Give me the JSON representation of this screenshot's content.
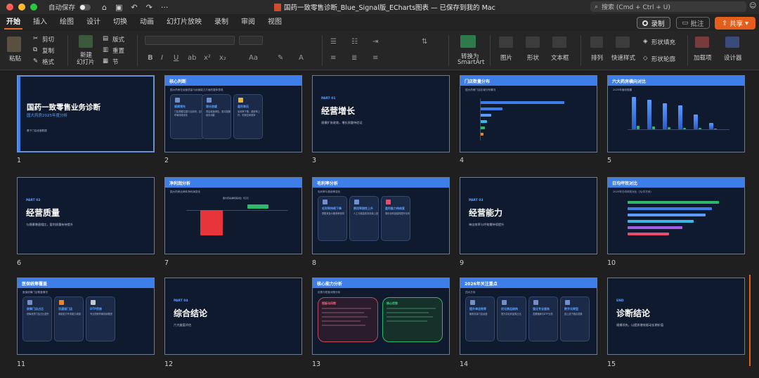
{
  "titlebar": {
    "autosave_label": "自动保存",
    "doc_title": "国药一致零售诊断_Blue_Signal版_ECharts图表 — 已保存到我的 Mac",
    "search_placeholder": "搜索 (Cmd + Ctrl + U)"
  },
  "tabs": [
    "开始",
    "插入",
    "绘图",
    "设计",
    "切换",
    "动画",
    "幻灯片放映",
    "录制",
    "审阅",
    "视图"
  ],
  "tab_active": "开始",
  "actions": {
    "record": "录制",
    "comment": "批注",
    "share": "共享"
  },
  "ribbon": {
    "paste": "粘贴",
    "cut": "剪切",
    "copy": "复制",
    "format": "格式",
    "new_slide_1": "新建",
    "new_slide_2": "幻灯片",
    "layout": "版式",
    "reset": "重置",
    "section": "节",
    "smartart_1": "转换为",
    "smartart_2": "SmartArt",
    "picture": "图片",
    "shape": "形状",
    "textbox": "文本框",
    "arrange": "排列",
    "quick_styles": "快速样式",
    "shape_fill": "形状填充",
    "shape_outline": "形状轮廓",
    "addins": "加载项",
    "designer": "设计器"
  },
  "slides": [
    {
      "num": "1",
      "title": "国药一致零售业务诊断",
      "subtitle": "国大药房2025年度分析",
      "footer": "基于门店经营数据"
    },
    {
      "num": "2",
      "header": "核心判断",
      "sub": "国大药房在经营质量与经营能力方面的整体表现",
      "cards": [
        {
          "title": "规模领先",
          "desc": "门店规模位居行业前列，区域布局持续优化"
        },
        {
          "title": "增长放缓",
          "desc": "同店增速承压，需寻找新增长动能"
        },
        {
          "title": "盈利承压",
          "desc": "毛利率下降，费用率上升，利润空间收窄"
        }
      ]
    },
    {
      "num": "3",
      "part": "PART 01",
      "title": "经营增长",
      "desc": "规模扩张收敛，增长质量待验证"
    },
    {
      "num": "4",
      "header": "门店数量分布",
      "sub": "国大药房门店区域分布情况"
    },
    {
      "num": "5",
      "header": "六大药房横向对比",
      "sub": "2025年营收规模"
    },
    {
      "num": "6",
      "part": "PART 02",
      "title": "经营质量",
      "desc": "与规模增速相比，盈利质量有待提升"
    },
    {
      "num": "7",
      "header": "净利润分析",
      "sub": "国大药房近两年净利润变化",
      "chart_title": "国大药房净利润对比（亿元）"
    },
    {
      "num": "8",
      "header": "毛利率分析",
      "sub": "毛利率与费用率变化",
      "cards": [
        {
          "title": "毛利率持续下降",
          "desc": "受集采及价格竞争影响"
        },
        {
          "title": "费用率刚性上升",
          "desc": "人工与租金成本持续上涨"
        },
        {
          "title": "盈利能力待修复",
          "desc": "需优化商品结构提升毛利"
        }
      ]
    },
    {
      "num": "9",
      "part": "PART 03",
      "title": "经营能力",
      "desc": "单店效率与坪效需持续提升"
    },
    {
      "num": "10",
      "header": "日均坪效对比",
      "sub": "2025年日均坪效对比（元/平方米）"
    },
    {
      "num": "11",
      "header": "医保统筹覆盖",
      "sub": "医保统筹门店覆盖情况",
      "cards": [
        {
          "title": "统筹门店占比",
          "desc": "统筹资质门店占比提升"
        },
        {
          "title": "双通道门店",
          "desc": "承接处方外流能力增强"
        },
        {
          "title": "DTP药房",
          "desc": "专业药房布局持续推进"
        }
      ]
    },
    {
      "num": "12",
      "part": "PART 04",
      "title": "综合结论",
      "desc": "六大维度评估"
    },
    {
      "num": "13",
      "header": "核心能力分析",
      "sub": "优势与短板对照分析",
      "left_title": "短板与风险",
      "right_title": "核心优势"
    },
    {
      "num": "14",
      "header": "2026年关注重点",
      "sub": "四大方向",
      "cards": [
        {
          "title": "提升单店效率",
          "desc": "聚焦存量门店经营"
        },
        {
          "title": "优化商品结构",
          "desc": "提升高毛利品类占比"
        },
        {
          "title": "强化专业服务",
          "desc": "发展慢病与DTP业务"
        },
        {
          "title": "数字化转型",
          "desc": "线上线下融合发展"
        }
      ]
    },
    {
      "num": "15",
      "part": "END",
      "title": "诊断结论",
      "desc": "规模领先，以提质增效驱动长期价值"
    }
  ],
  "chart_data": [
    {
      "type": "bar",
      "orientation": "horizontal",
      "slide": "4",
      "values": [
        100,
        27,
        13,
        8,
        6,
        4
      ],
      "colors": [
        "#3d7ee8",
        "#3d7ee8",
        "#5b9bff",
        "#37b8e6",
        "#2fb86a",
        "#e8862a"
      ]
    },
    {
      "type": "bar",
      "slide": "5",
      "series": [
        {
          "values": [
            95,
            88,
            78,
            70,
            44,
            18
          ]
        },
        {
          "values": [
            10,
            8,
            6,
            5,
            4,
            3
          ]
        }
      ]
    },
    {
      "type": "bar",
      "slide": "7",
      "values": [
        -8.5,
        1.5
      ]
    },
    {
      "type": "bar",
      "orientation": "horizontal",
      "slide": "10",
      "values": [
        100,
        92,
        85,
        72,
        60,
        45
      ],
      "colors": [
        "#2fb86a",
        "#3d7ee8",
        "#5b9bff",
        "#37b8e6",
        "#a35ee8",
        "#e84d6b"
      ]
    }
  ]
}
